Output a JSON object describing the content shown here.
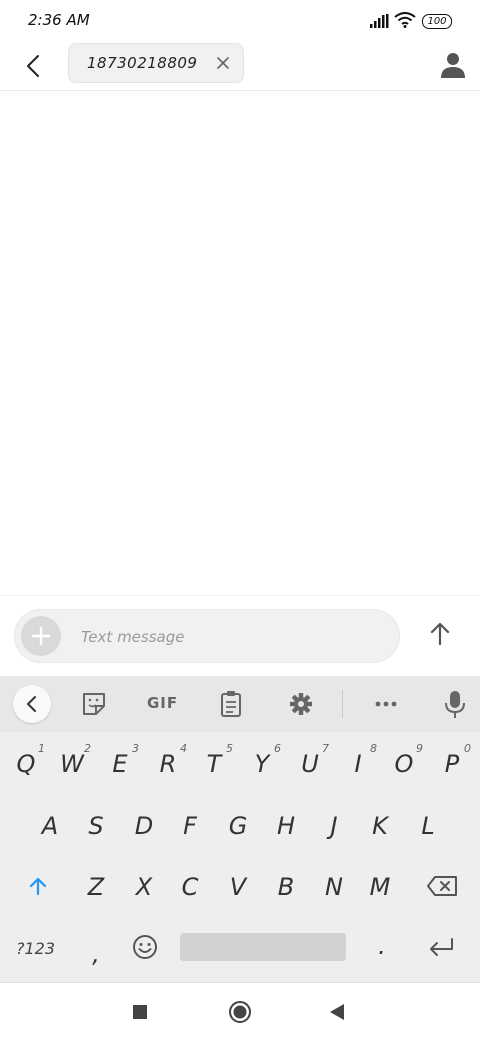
{
  "status_bar": {
    "time": "2:36 AM",
    "battery": "100"
  },
  "header": {
    "recipient": "18730218809"
  },
  "compose": {
    "placeholder": "Text message"
  },
  "keyboard": {
    "toolbar_gif": "GIF",
    "row1": [
      {
        "key": "Q",
        "hint": "1"
      },
      {
        "key": "W",
        "hint": "2"
      },
      {
        "key": "E",
        "hint": "3"
      },
      {
        "key": "R",
        "hint": "4"
      },
      {
        "key": "T",
        "hint": "5"
      },
      {
        "key": "Y",
        "hint": "6"
      },
      {
        "key": "U",
        "hint": "7"
      },
      {
        "key": "I",
        "hint": "8"
      },
      {
        "key": "O",
        "hint": "9"
      },
      {
        "key": "P",
        "hint": "0"
      }
    ],
    "row2": [
      "A",
      "S",
      "D",
      "F",
      "G",
      "H",
      "J",
      "K",
      "L"
    ],
    "row3": [
      "Z",
      "X",
      "C",
      "V",
      "B",
      "N",
      "M"
    ],
    "symbols_key": "?123",
    "comma": ",",
    "period": "."
  }
}
